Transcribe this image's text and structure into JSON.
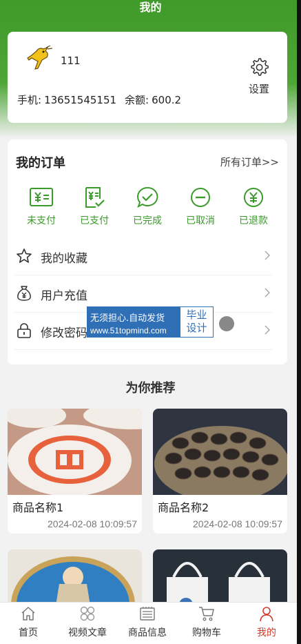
{
  "page": {
    "title": "我的"
  },
  "profile": {
    "username": "111",
    "phone_label": "手机:",
    "phone": "13651545151",
    "balance_label": "余额:",
    "balance": "600.2",
    "settings_label": "设置",
    "avatar_icon": "deer-figure-avatar"
  },
  "orders": {
    "title": "我的订单",
    "all_link": "所有订单>>",
    "statuses": [
      {
        "label": "未支付",
        "icon": "unpaid-bill-icon"
      },
      {
        "label": "已支付",
        "icon": "paid-bill-icon"
      },
      {
        "label": "已完成",
        "icon": "chat-check-icon"
      },
      {
        "label": "已取消",
        "icon": "cancel-circle-icon"
      },
      {
        "label": "已退款",
        "icon": "yen-circle-icon"
      }
    ],
    "accent_color": "#3a9a2a"
  },
  "menu": [
    {
      "label": "我的收藏",
      "icon": "star-icon"
    },
    {
      "label": "用户充值",
      "icon": "money-bag-icon"
    },
    {
      "label": "修改密码",
      "icon": "lock-icon"
    }
  ],
  "watermark": {
    "text": "无须担心.自动发货",
    "url": "www.51topmind.com",
    "side_line1": "毕业",
    "side_line2": "设计"
  },
  "recommend": {
    "title": "为你推荐",
    "products": [
      {
        "name": "商品名称1",
        "time": "2024-02-08 10:09:57",
        "image": "pastry-with-red-stamp"
      },
      {
        "name": "商品名称2",
        "time": "2024-02-08 10:09:57",
        "image": "basket-of-dark-dumplings"
      },
      {
        "name": "",
        "time": "",
        "image": "embroidery-hoop-figure"
      },
      {
        "name": "",
        "time": "",
        "image": "tote-bags"
      }
    ]
  },
  "nav": [
    {
      "label": "首页",
      "icon": "home-icon"
    },
    {
      "label": "视频文章",
      "icon": "grid-icon"
    },
    {
      "label": "商品信息",
      "icon": "news-icon"
    },
    {
      "label": "购物车",
      "icon": "cart-icon"
    },
    {
      "label": "我的",
      "icon": "user-icon",
      "active": true
    }
  ],
  "colors": {
    "brand_green": "#4ea637",
    "active_red": "#d33a2c",
    "watermark_blue": "#2f6fb5"
  }
}
